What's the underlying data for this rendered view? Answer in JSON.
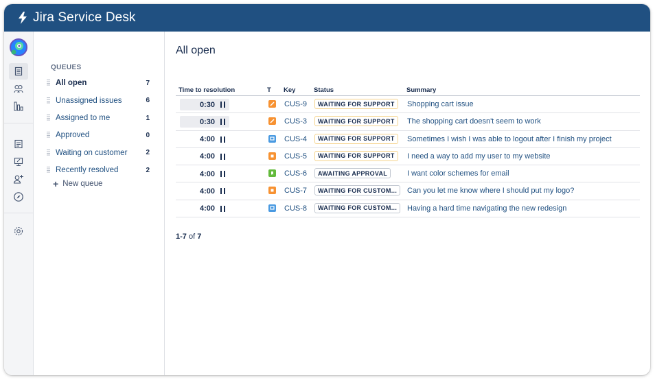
{
  "app": {
    "title": "Jira Service Desk"
  },
  "colors": {
    "brand": "#205081",
    "link": "#205081",
    "waiting_border": "#f5d28a"
  },
  "iconbar": {
    "icons": [
      "project-avatar-icon",
      "queues-icon",
      "customers-icon",
      "reports-icon",
      "knowledge-base-icon",
      "raise-request-icon",
      "add-people-icon",
      "compass-icon",
      "settings-icon"
    ]
  },
  "queues": {
    "heading": "QUEUES",
    "items": [
      {
        "label": "All open",
        "count": "7"
      },
      {
        "label": "Unassigned issues",
        "count": "6"
      },
      {
        "label": "Assigned to me",
        "count": "1"
      },
      {
        "label": "Approved",
        "count": "0"
      },
      {
        "label": "Waiting on customer",
        "count": "2"
      },
      {
        "label": "Recently resolved",
        "count": "2"
      }
    ],
    "new_queue_label": "New queue"
  },
  "main": {
    "title": "All open",
    "columns": {
      "time": "Time to resolution",
      "type": "T",
      "key": "Key",
      "status": "Status",
      "summary": "Summary"
    },
    "rows": [
      {
        "time": "0:30",
        "type_icon": "task-icon",
        "type_color": "#f79232",
        "key": "CUS-9",
        "status": "WAITING FOR SUPPORT",
        "summary": "Shopping cart issue"
      },
      {
        "time": "0:30",
        "type_icon": "task-icon",
        "type_color": "#f79232",
        "key": "CUS-3",
        "status": "WAITING FOR SUPPORT",
        "summary": "The shopping cart doesn't seem to work"
      },
      {
        "time": "4:00",
        "type_icon": "question-icon",
        "type_color": "#4a9ae1",
        "key": "CUS-4",
        "status": "WAITING FOR SUPPORT",
        "summary": "Sometimes I wish I was able to logout after I finish my project"
      },
      {
        "time": "4:00",
        "type_icon": "bug-icon",
        "type_color": "#f79232",
        "key": "CUS-5",
        "status": "WAITING FOR SUPPORT",
        "summary": "I need a way to add my user to my website"
      },
      {
        "time": "4:00",
        "type_icon": "story-icon",
        "type_color": "#63ba3c",
        "key": "CUS-6",
        "status": "AWAITING APPROVAL",
        "summary": "I want color schemes for email"
      },
      {
        "time": "4:00",
        "type_icon": "bug-icon",
        "type_color": "#f79232",
        "key": "CUS-7",
        "status": "WAITING FOR CUSTOM...",
        "summary": "Can you let me know where I should put my logo?"
      },
      {
        "time": "4:00",
        "type_icon": "question-icon",
        "type_color": "#4a9ae1",
        "key": "CUS-8",
        "status": "WAITING FOR CUSTOM...",
        "summary": "Having a hard time navigating the new redesign"
      }
    ],
    "pager": {
      "range": "1-7",
      "of": "of",
      "total": "7"
    }
  }
}
